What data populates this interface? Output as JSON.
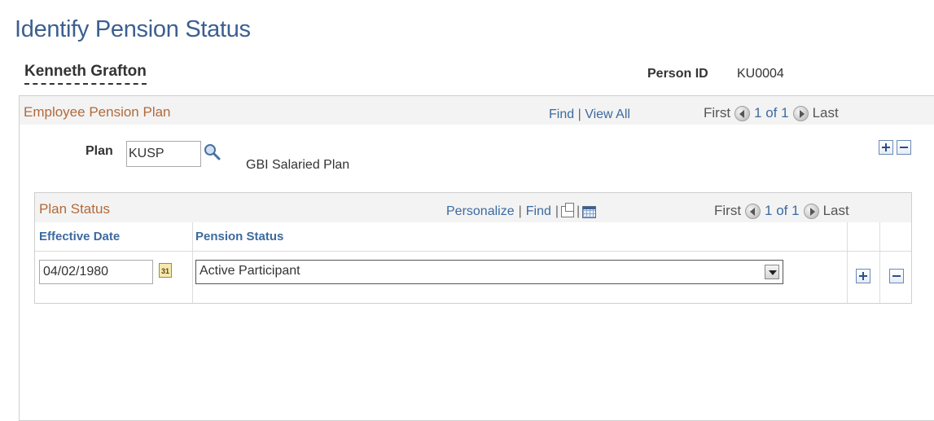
{
  "page": {
    "title": "Identify Pension Status"
  },
  "person": {
    "name": "Kenneth Grafton",
    "id_label": "Person ID",
    "id_value": "KU0004"
  },
  "pension_plan_section": {
    "title": "Employee Pension Plan",
    "nav": {
      "find": "Find",
      "separator": "|",
      "view_all": "View All",
      "first": "First",
      "count": "1 of 1",
      "last": "Last"
    },
    "plan_label": "Plan",
    "plan_value": "KUSP",
    "plan_description": "GBI Salaried Plan"
  },
  "plan_status_section": {
    "title": "Plan Status",
    "nav": {
      "personalize": "Personalize",
      "separator": "|",
      "find": "Find",
      "first": "First",
      "count": "1 of 1",
      "last": "Last"
    },
    "columns": [
      "Effective Date",
      "Pension Status"
    ],
    "rows": [
      {
        "effective_date": "04/02/1980",
        "pension_status": "Active Participant"
      }
    ],
    "calendar_icon_text": "31"
  },
  "icons": {
    "lookup": "magnifier-icon",
    "calendar": "calendar-icon",
    "prev": "arrow-left-circle-icon",
    "next": "arrow-right-circle-icon",
    "zoom": "new-window-icon",
    "grid": "download-grid-icon",
    "add": "plus-icon",
    "delete": "minus-icon"
  },
  "colors": {
    "title": "#3c5f8f",
    "section_title": "#b36a3a",
    "link": "#3c6a9f",
    "header_bg": "#f3f3f3"
  }
}
